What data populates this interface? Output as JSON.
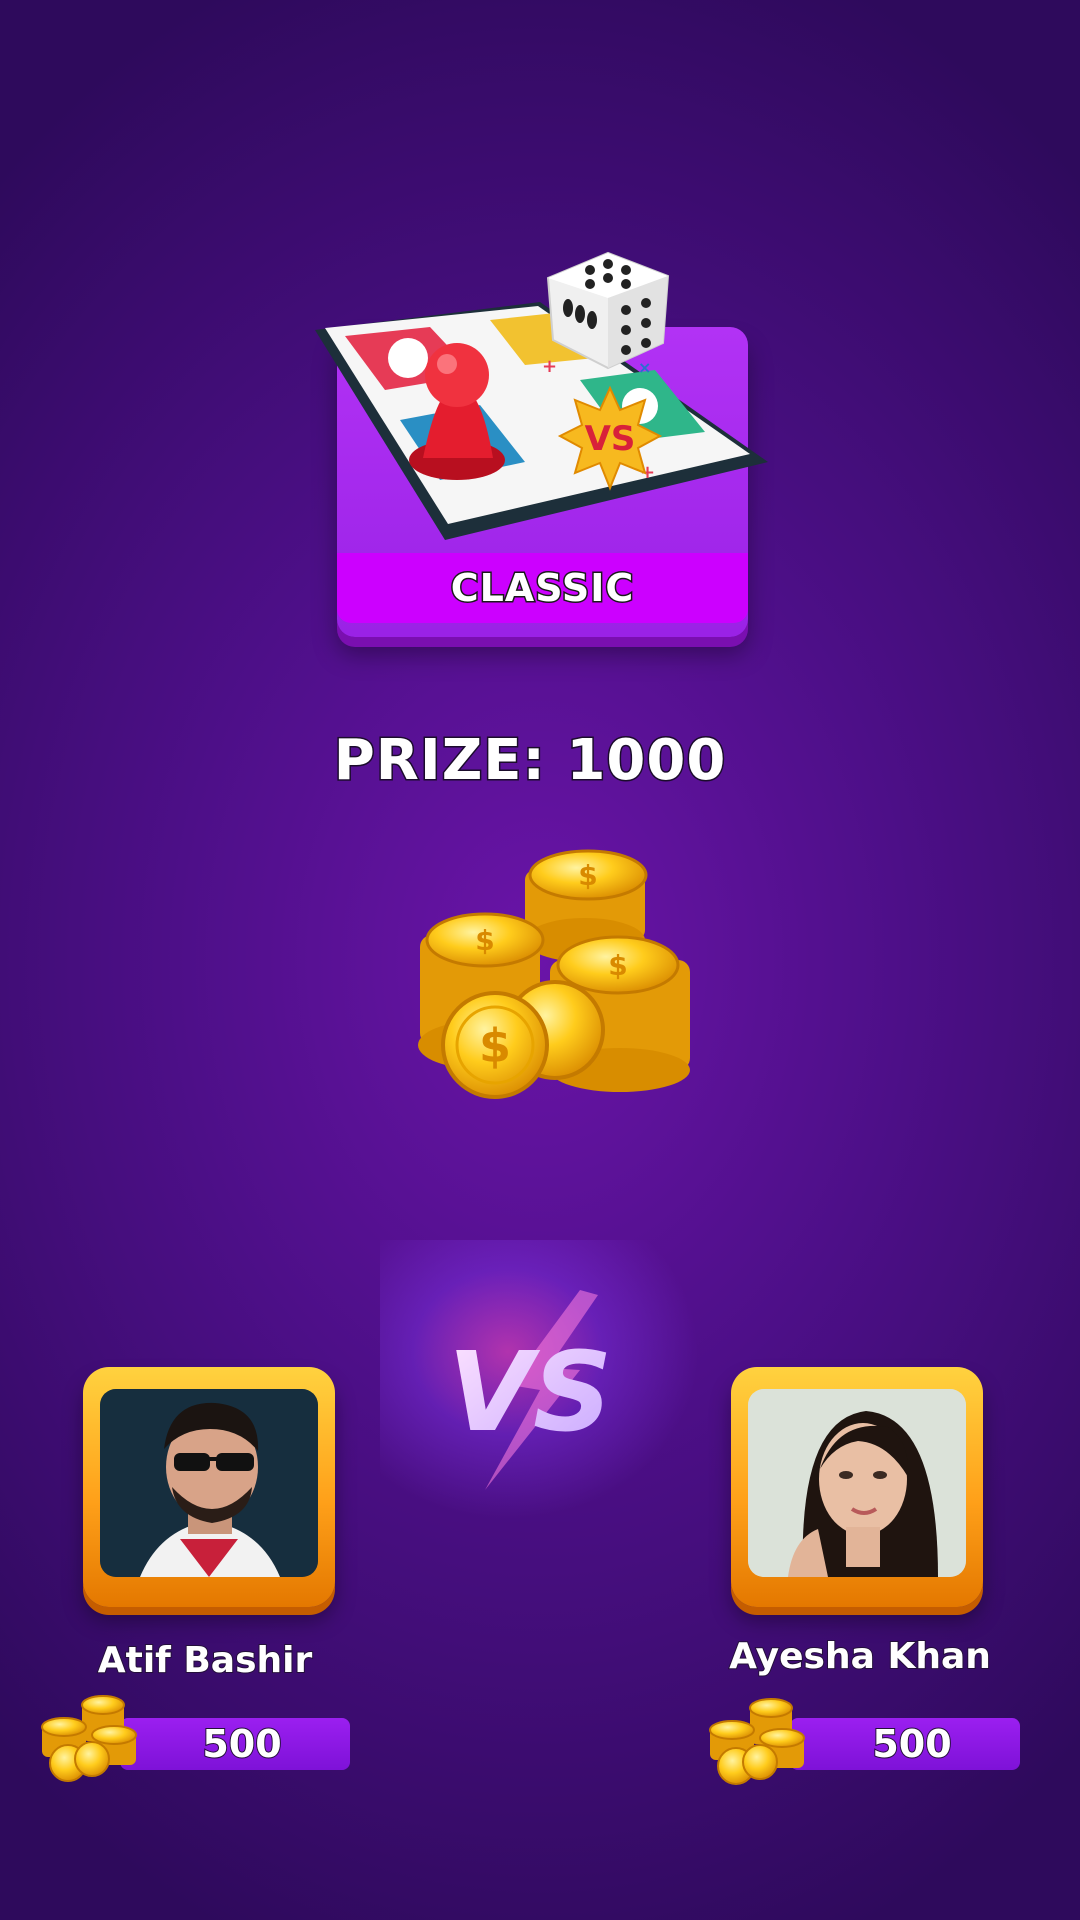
{
  "mode": {
    "label": "CLASSIC",
    "badge": "VS"
  },
  "prize": {
    "text": "PRIZE: 1000"
  },
  "versus": {
    "text": "VS"
  },
  "players": [
    {
      "name": "Atif Bashir",
      "coins": "500"
    },
    {
      "name": "Ayesha Khan",
      "coins": "500"
    }
  ],
  "colors": {
    "background": "#4d0f88",
    "card": "#a62cf0",
    "band": "#cc00ff",
    "coin_bar": "#8a18e4",
    "frame": "#ffb020"
  }
}
